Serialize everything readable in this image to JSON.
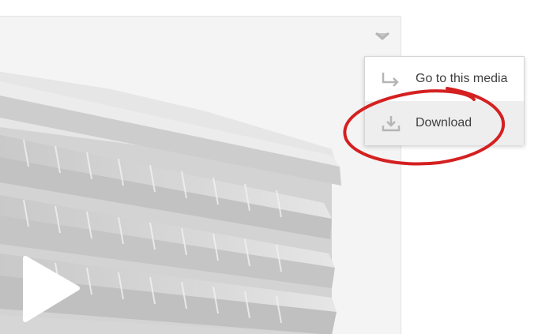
{
  "menu": {
    "items": [
      {
        "label": "Go to this media",
        "icon": "go-to-arrow-icon"
      },
      {
        "label": "Download",
        "icon": "download-icon"
      }
    ]
  },
  "media": {
    "play_icon": "play-icon",
    "menu_toggle_icon": "chevron-down-icon"
  },
  "colors": {
    "annotation": "#d42020",
    "menu_hover": "#eeeeee",
    "icon": "#b5b5b5"
  }
}
